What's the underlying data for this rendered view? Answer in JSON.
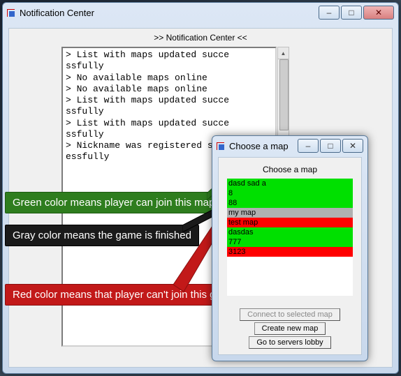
{
  "main_window": {
    "title": "Notification Center",
    "header": ">> Notification Center <<",
    "log_lines": [
      "> List with maps updated successfully",
      "> No available maps online",
      "> No available maps online",
      "> List with maps updated successfully",
      "> List with maps updated successfully",
      "> Nickname was registered successfully"
    ]
  },
  "map_window": {
    "title": "Choose a map",
    "header": "Choose a map",
    "items": [
      {
        "label": "dasd sad a",
        "status": "g"
      },
      {
        "label": "8",
        "status": "g"
      },
      {
        "label": "88",
        "status": "g"
      },
      {
        "label": "my map",
        "status": "gr"
      },
      {
        "label": "test map",
        "status": "r"
      },
      {
        "label": "dasdas",
        "status": "g"
      },
      {
        "label": "777",
        "status": "g"
      },
      {
        "label": "3123",
        "status": "r"
      }
    ],
    "btn_connect": "Connect to selected map",
    "btn_create": "Create new map",
    "btn_lobby": "Go to servers lobby"
  },
  "callouts": {
    "green": "Green color means player can join this map",
    "gray": "Gray color means the game is finished",
    "red": "Red color means that player can't join this game map"
  },
  "win_buttons": {
    "min": "–",
    "max": "□",
    "close": "✕"
  }
}
